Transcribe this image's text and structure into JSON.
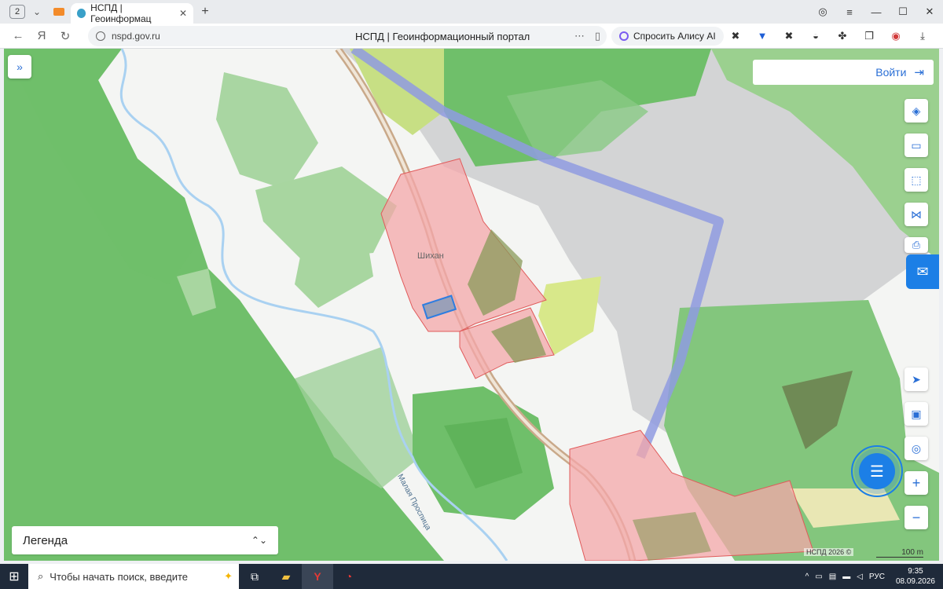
{
  "browser": {
    "tab_count": "2",
    "active_tab_title": "НСПД | Геоинформац",
    "url": "nspd.gov.ru",
    "page_title": "НСПД | Геоинформационный портал",
    "alice_label": "Спросить Алису AI"
  },
  "map": {
    "login_label": "Войти",
    "legend_label": "Легенда",
    "place_label": "Шихан",
    "river_label": "Малая Проспица",
    "copyright": "НСПД 2026 ©",
    "scale": "100 m"
  },
  "taskbar": {
    "search_placeholder": "Чтобы начать поиск, введите",
    "lang": "РУС",
    "time": "9:35",
    "date": "08.09.2026"
  },
  "colors": {
    "forest": "#6fbf6a",
    "light_green": "#a8d8a0",
    "gray_area": "#d2d3d4",
    "parcel_fill": "#f4a7a9",
    "parcel_stroke": "#e05a5a",
    "blue_line": "#8f9be0",
    "accent": "#1c7fe6"
  }
}
